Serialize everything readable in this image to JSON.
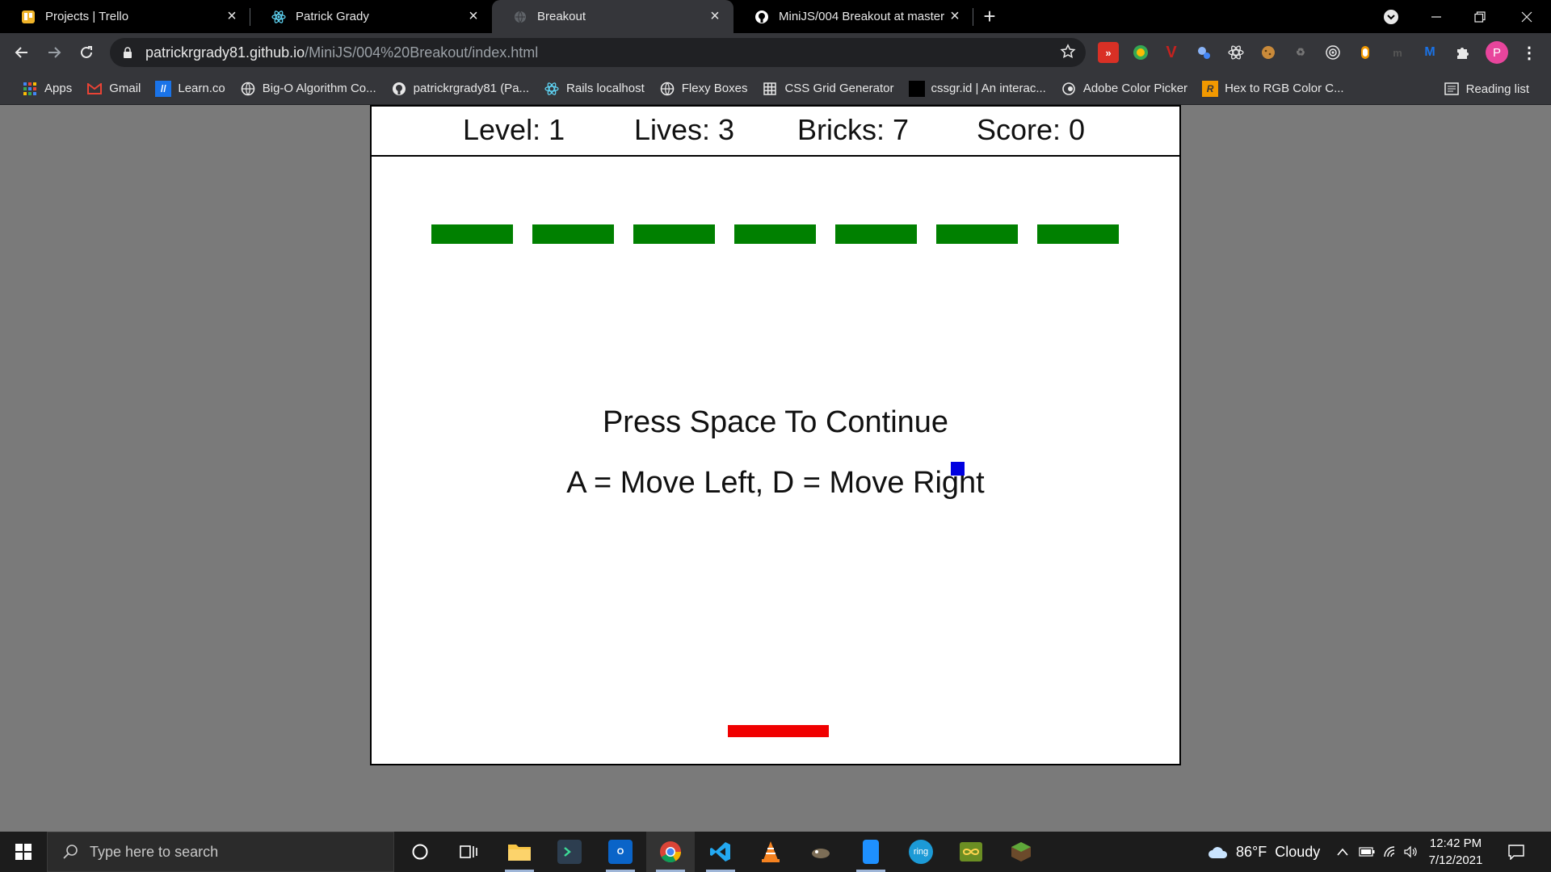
{
  "browser": {
    "tabs": [
      {
        "title": "Projects | Trello",
        "icon": "trello-icon",
        "active": false
      },
      {
        "title": "Patrick Grady",
        "icon": "react-icon",
        "active": false
      },
      {
        "title": "Breakout",
        "icon": "globe-icon",
        "active": true
      },
      {
        "title": "MiniJS/004 Breakout at master · p",
        "icon": "github-icon",
        "active": false
      }
    ],
    "url_host": "patrickrgrady81.github.io",
    "url_path": "/MiniJS/004%20Breakout/index.html",
    "profile_initial": "P",
    "bookmarks": [
      {
        "label": "Apps",
        "icon": "apps-grid-icon"
      },
      {
        "label": "Gmail",
        "icon": "gmail-icon"
      },
      {
        "label": "Learn.co",
        "icon": "learnco-icon"
      },
      {
        "label": "Big-O Algorithm Co...",
        "icon": "globe-icon"
      },
      {
        "label": "patrickrgrady81 (Pa...",
        "icon": "github-icon"
      },
      {
        "label": "Rails localhost",
        "icon": "react-icon"
      },
      {
        "label": "Flexy Boxes",
        "icon": "globe-icon"
      },
      {
        "label": "CSS Grid Generator",
        "icon": "grid-icon"
      },
      {
        "label": "cssgr.id | An interac...",
        "icon": "black-square-icon"
      },
      {
        "label": "Adobe Color Picker",
        "icon": "adobe-color-icon"
      },
      {
        "label": "Hex to RGB Color C...",
        "icon": "r-icon"
      }
    ],
    "reading_list": "Reading list"
  },
  "game": {
    "hud": {
      "level": "Level: 1",
      "lives": "Lives: 3",
      "bricks": "Bricks: 7",
      "score": "Score: 0"
    },
    "brick_count": 7,
    "brick_color": "#008000",
    "ball_color": "#0000e0",
    "paddle_color": "#f00000",
    "message_line1": "Press Space To Continue",
    "message_line2": "A = Move Left, D = Move Right"
  },
  "taskbar": {
    "search_placeholder": "Type here to search",
    "weather": "86°F  Cloudy",
    "time": "12:42 PM",
    "date": "7/12/2021"
  }
}
